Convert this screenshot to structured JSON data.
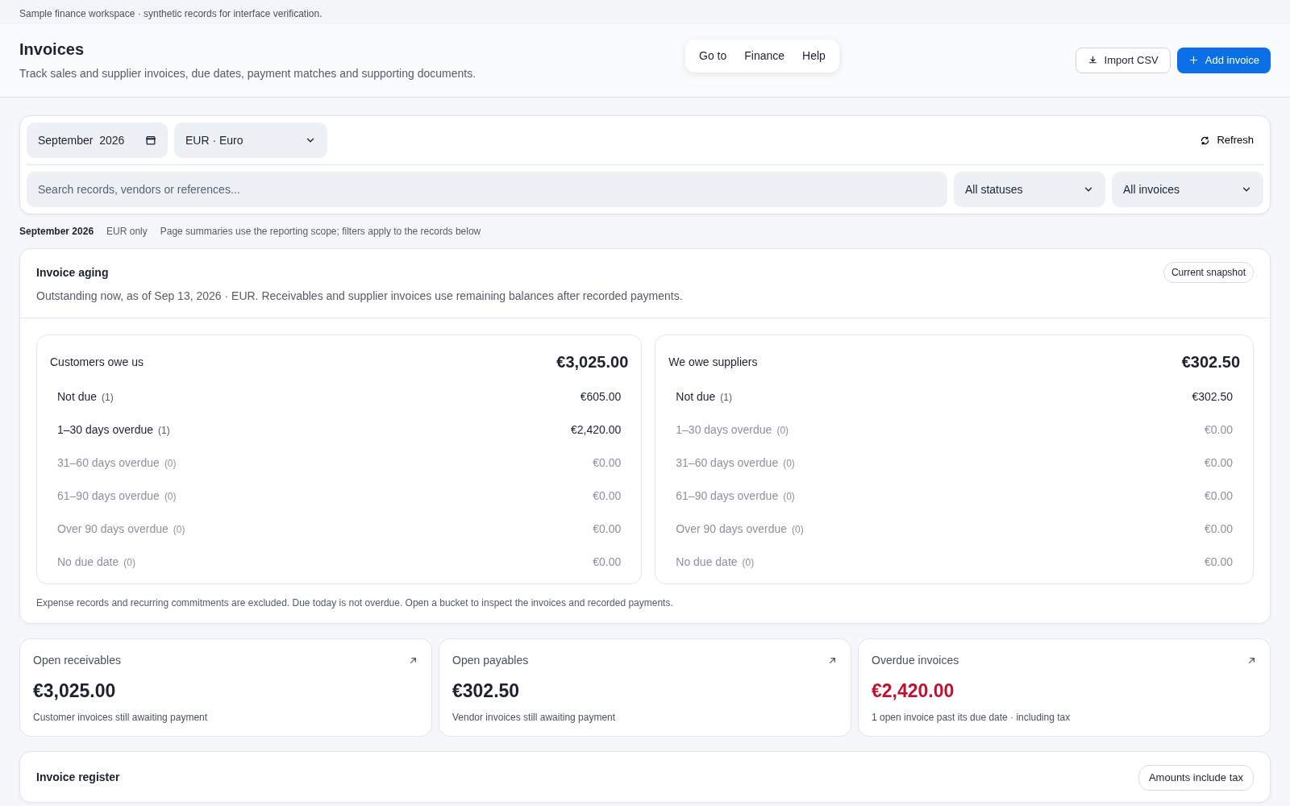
{
  "notice": "Sample finance workspace · synthetic records for interface verification.",
  "header": {
    "title": "Invoices",
    "subtitle": "Track sales and supplier invoices, due dates, payment matches and supporting documents.",
    "menu": [
      "Go to",
      "Finance",
      "Help"
    ],
    "actions": [
      {
        "label": "Import CSV",
        "kind": "import"
      },
      {
        "label": "Add invoice",
        "kind": "add"
      }
    ]
  },
  "filters": {
    "month": "September  2026",
    "currency": "EUR · Euro",
    "refresh": "Refresh",
    "search_placeholder": "Search records, vendors or references...",
    "status": "All statuses",
    "type": "All invoices"
  },
  "scope": [
    "September 2026",
    "EUR only",
    "Page summaries use the reporting scope; filters apply to the records below"
  ],
  "aging": {
    "title": "Invoice aging",
    "badge": "Current snapshot",
    "subtitle": "Outstanding now, as of Sep 13, 2026 · EUR. Receivables and supplier invoices use remaining balances after recorded payments.",
    "panels": [
      {
        "title": "Customers owe us",
        "total": "€3,025.00",
        "buckets": [
          {
            "label": "Not due",
            "count": "(1)",
            "amount": "€605.00",
            "empty": false
          },
          {
            "label": "1–30 days overdue",
            "count": "(1)",
            "amount": "€2,420.00",
            "empty": false
          },
          {
            "label": "31–60 days overdue",
            "count": "(0)",
            "amount": "€0.00",
            "empty": true
          },
          {
            "label": "61–90 days overdue",
            "count": "(0)",
            "amount": "€0.00",
            "empty": true
          },
          {
            "label": "Over 90 days overdue",
            "count": "(0)",
            "amount": "€0.00",
            "empty": true
          },
          {
            "label": "No due date",
            "count": "(0)",
            "amount": "€0.00",
            "empty": true
          }
        ]
      },
      {
        "title": "We owe suppliers",
        "total": "€302.50",
        "buckets": [
          {
            "label": "Not due",
            "count": "(1)",
            "amount": "€302.50",
            "empty": false
          },
          {
            "label": "1–30 days overdue",
            "count": "(0)",
            "amount": "€0.00",
            "empty": true
          },
          {
            "label": "31–60 days overdue",
            "count": "(0)",
            "amount": "€0.00",
            "empty": true
          },
          {
            "label": "61–90 days overdue",
            "count": "(0)",
            "amount": "€0.00",
            "empty": true
          },
          {
            "label": "Over 90 days overdue",
            "count": "(0)",
            "amount": "€0.00",
            "empty": true
          },
          {
            "label": "No due date",
            "count": "(0)",
            "amount": "€0.00",
            "empty": true
          }
        ]
      }
    ],
    "footnote": "Expense records and recurring commitments are excluded. Due today is not overdue. Open a bucket to inspect the invoices and recorded payments."
  },
  "stats": [
    {
      "title": "Open receivables",
      "value": "€3,025.00",
      "note": "Customer invoices still awaiting payment",
      "alert": false
    },
    {
      "title": "Open payables",
      "value": "€302.50",
      "note": "Vendor invoices still awaiting payment",
      "alert": false
    },
    {
      "title": "Overdue invoices",
      "value": "€2,420.00",
      "note": "1 open invoice past its due date · including tax",
      "alert": true
    }
  ],
  "register": {
    "title": "Invoice register",
    "badge": "Amounts include tax"
  }
}
